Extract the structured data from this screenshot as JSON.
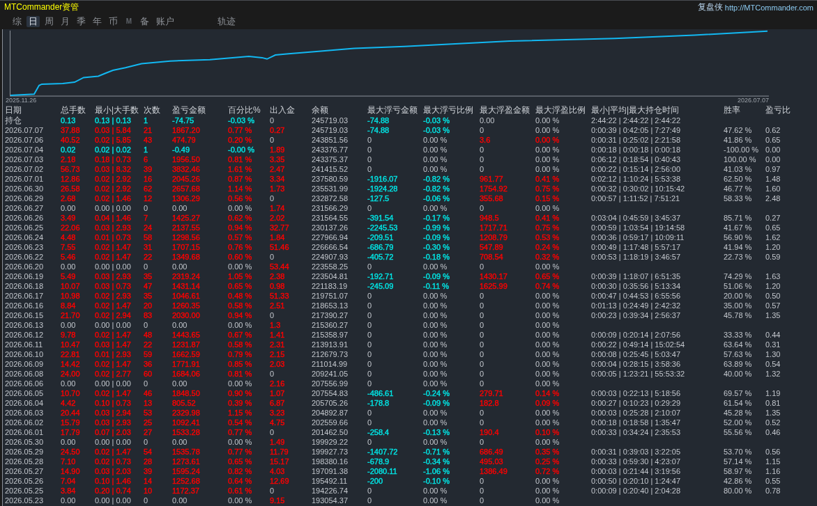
{
  "window": {
    "title": "MTCommander资管"
  },
  "header": {
    "brand": "复盘侠",
    "link": "http://MTCommander.com"
  },
  "tab_groups": [
    {
      "tabs": [
        {
          "label": "综",
          "selected": false,
          "disabled": false
        },
        {
          "label": "日",
          "selected": true,
          "disabled": false
        },
        {
          "label": "周",
          "selected": false,
          "disabled": false
        },
        {
          "label": "月",
          "selected": false,
          "disabled": false
        },
        {
          "label": "季",
          "selected": false,
          "disabled": false
        },
        {
          "label": "年",
          "selected": false,
          "disabled": false
        },
        {
          "label": "币",
          "selected": false,
          "disabled": false
        },
        {
          "label": "M",
          "selected": false,
          "disabled": true
        },
        {
          "label": "备",
          "selected": false,
          "disabled": false
        },
        {
          "label": "账户",
          "selected": false,
          "disabled": false
        }
      ]
    },
    {
      "tabs": [
        {
          "label": "轨迹",
          "selected": false,
          "disabled": false
        }
      ]
    }
  ],
  "chart": {
    "start_label": "2025.11.26",
    "end_label": "2026.07.07"
  },
  "table": {
    "columns": [
      "日期",
      "总手数",
      "最小|大手数",
      "次数",
      "盈亏金额",
      "百分比%",
      "出入金",
      "余额",
      "最大浮亏金额",
      "最大浮亏比例",
      "最大浮盈金额",
      "最大浮盈比例",
      "最小|平均|最大持仓时间",
      "胜率",
      "盈亏比"
    ],
    "summary_row": {
      "cells": [
        "持仓",
        {
          "text": "0.13",
          "color": "#00e6e6"
        },
        {
          "text": "0.13 | 0.13",
          "color": "#00e6e6"
        },
        {
          "text": "1",
          "color": "#00e6e6"
        },
        {
          "text": "-74.75",
          "color": "#00e6e6"
        },
        {
          "text": "-0.03 %",
          "color": "#00e6e6"
        },
        "0",
        "245719.03",
        {
          "text": "-74.88",
          "color": "#00e6e6"
        },
        {
          "text": "-0.03 %",
          "color": "#00e6e6"
        },
        "0.00",
        "0.00 %",
        "2:44:22 | 2:44:22 | 2:44:22"
      ]
    },
    "rows": [
      {
        "cells": [
          "2026.07.07",
          {
            "text": "37.88",
            "color": "#ff0000"
          },
          {
            "text": "0.03 | 5.84",
            "color": "#ff0000"
          },
          {
            "text": "21",
            "color": "#ff0000"
          },
          {
            "text": "1867.20",
            "color": "#ff0000"
          },
          {
            "text": "0.77 %",
            "color": "#ff0000"
          },
          {
            "text": "0.27",
            "color": "#ff0000"
          },
          "245719.03",
          {
            "text": "-74.88",
            "color": "#00e6e6"
          },
          {
            "text": "-0.03 %",
            "color": "#00e6e6"
          },
          "0",
          "0.00 %",
          "0:00:39 | 0:42:05 | 7:27:49",
          "47.62 %",
          "0.62"
        ]
      },
      {
        "cells": [
          "2026.07.06",
          {
            "text": "40.52",
            "color": "#ff0000"
          },
          {
            "text": "0.02 | 5.85",
            "color": "#ff0000"
          },
          {
            "text": "43",
            "color": "#ff0000"
          },
          {
            "text": "474.79",
            "color": "#ff0000"
          },
          {
            "text": "0.20 %",
            "color": "#ff0000"
          },
          "0",
          "243851.56",
          "0",
          "0.00 %",
          {
            "text": "3.6",
            "color": "#ff0000"
          },
          {
            "text": "0.00 %",
            "color": "#ff0000"
          },
          "0:00:31 | 0:25:02 | 2:21:58",
          "41.86 %",
          "0.65"
        ]
      },
      {
        "cells": [
          "2026.07.04",
          {
            "text": "0.02",
            "color": "#00e6e6"
          },
          {
            "text": "0.02 | 0.02",
            "color": "#00e6e6"
          },
          {
            "text": "1",
            "color": "#00e6e6"
          },
          {
            "text": "-0.49",
            "color": "#00e6e6"
          },
          {
            "text": "-0.00 %",
            "color": "#00e6e6"
          },
          {
            "text": "1.89",
            "color": "#ff0000"
          },
          "243376.77",
          "0",
          "0.00 %",
          "0",
          "0.00 %",
          "0:00:18 | 0:00:18 | 0:00:18",
          "-100.00 %",
          "0.00"
        ]
      },
      {
        "cells": [
          "2026.07.03",
          {
            "text": "2.18",
            "color": "#ff0000"
          },
          {
            "text": "0.18 | 0.73",
            "color": "#ff0000"
          },
          {
            "text": "6",
            "color": "#ff0000"
          },
          {
            "text": "1956.50",
            "color": "#ff0000"
          },
          {
            "text": "0.81 %",
            "color": "#ff0000"
          },
          {
            "text": "3.35",
            "color": "#ff0000"
          },
          "243375.37",
          "0",
          "0.00 %",
          "0",
          "0.00 %",
          "0:06:12 | 0:18:54 | 0:40:43",
          "100.00 %",
          "0.00"
        ]
      },
      {
        "cells": [
          "2026.07.02",
          {
            "text": "56.73",
            "color": "#ff0000"
          },
          {
            "text": "0.03 | 8.32",
            "color": "#ff0000"
          },
          {
            "text": "39",
            "color": "#ff0000"
          },
          {
            "text": "3832.46",
            "color": "#ff0000"
          },
          {
            "text": "1.61 %",
            "color": "#ff0000"
          },
          {
            "text": "2.47",
            "color": "#ff0000"
          },
          "241415.52",
          "0",
          "0.00 %",
          "0",
          "0.00 %",
          "0:00:22 | 0:15:14 | 2:56:00",
          "41.03 %",
          "0.97"
        ]
      },
      {
        "cells": [
          "2026.07.01",
          {
            "text": "12.86",
            "color": "#ff0000"
          },
          {
            "text": "0.02 | 2.92",
            "color": "#ff0000"
          },
          {
            "text": "16",
            "color": "#ff0000"
          },
          {
            "text": "2045.26",
            "color": "#ff0000"
          },
          {
            "text": "0.87 %",
            "color": "#ff0000"
          },
          {
            "text": "3.34",
            "color": "#ff0000"
          },
          "237580.59",
          {
            "text": "-1916.07",
            "color": "#00e6e6"
          },
          {
            "text": "-0.82 %",
            "color": "#00e6e6"
          },
          {
            "text": "961.77",
            "color": "#ff0000"
          },
          {
            "text": "0.41 %",
            "color": "#ff0000"
          },
          "0:02:12 | 1:10:24 | 5:53:38",
          "62.50 %",
          "1.48"
        ]
      },
      {
        "cells": [
          "2026.06.30",
          {
            "text": "26.58",
            "color": "#ff0000"
          },
          {
            "text": "0.02 | 2.92",
            "color": "#ff0000"
          },
          {
            "text": "62",
            "color": "#ff0000"
          },
          {
            "text": "2657.68",
            "color": "#ff0000"
          },
          {
            "text": "1.14 %",
            "color": "#ff0000"
          },
          {
            "text": "1.73",
            "color": "#ff0000"
          },
          "235531.99",
          {
            "text": "-1924.28",
            "color": "#00e6e6"
          },
          {
            "text": "-0.82 %",
            "color": "#00e6e6"
          },
          {
            "text": "1754.92",
            "color": "#ff0000"
          },
          {
            "text": "0.75 %",
            "color": "#ff0000"
          },
          "0:00:32 | 0:30:02 | 10:15:42",
          "46.77 %",
          "1.60"
        ]
      },
      {
        "cells": [
          "2026.06.29",
          {
            "text": "2.68",
            "color": "#ff0000"
          },
          {
            "text": "0.02 | 1.46",
            "color": "#ff0000"
          },
          {
            "text": "12",
            "color": "#ff0000"
          },
          {
            "text": "1306.29",
            "color": "#ff0000"
          },
          {
            "text": "0.56 %",
            "color": "#ff0000"
          },
          "0",
          "232872.58",
          {
            "text": "-127.5",
            "color": "#00e6e6"
          },
          {
            "text": "-0.06 %",
            "color": "#00e6e6"
          },
          {
            "text": "355.68",
            "color": "#ff0000"
          },
          {
            "text": "0.15 %",
            "color": "#ff0000"
          },
          "0:00:57 | 1:11:52 | 7:51:21",
          "58.33 %",
          "2.48"
        ]
      },
      {
        "cells": [
          "2026.06.27",
          "0.00",
          "0.00 | 0.00",
          "0",
          "0.00",
          "0.00 %",
          {
            "text": "1.74",
            "color": "#ff0000"
          },
          "231566.29",
          "0",
          "0.00 %",
          "0",
          "0.00 %"
        ]
      },
      {
        "cells": [
          "2026.06.26",
          {
            "text": "3.49",
            "color": "#ff0000"
          },
          {
            "text": "0.04 | 1.46",
            "color": "#ff0000"
          },
          {
            "text": "7",
            "color": "#ff0000"
          },
          {
            "text": "1425.27",
            "color": "#ff0000"
          },
          {
            "text": "0.62 %",
            "color": "#ff0000"
          },
          {
            "text": "2.02",
            "color": "#ff0000"
          },
          "231564.55",
          {
            "text": "-391.54",
            "color": "#00e6e6"
          },
          {
            "text": "-0.17 %",
            "color": "#00e6e6"
          },
          {
            "text": "948.5",
            "color": "#ff0000"
          },
          {
            "text": "0.41 %",
            "color": "#ff0000"
          },
          "0:03:04 | 0:45:59 | 3:45:37",
          "85.71 %",
          "0.27"
        ]
      },
      {
        "cells": [
          "2026.06.25",
          {
            "text": "22.06",
            "color": "#ff0000"
          },
          {
            "text": "0.03 | 2.93",
            "color": "#ff0000"
          },
          {
            "text": "24",
            "color": "#ff0000"
          },
          {
            "text": "2137.55",
            "color": "#ff0000"
          },
          {
            "text": "0.94 %",
            "color": "#ff0000"
          },
          {
            "text": "32.77",
            "color": "#ff0000"
          },
          "230137.26",
          {
            "text": "-2245.53",
            "color": "#00e6e6"
          },
          {
            "text": "-0.99 %",
            "color": "#00e6e6"
          },
          {
            "text": "1717.71",
            "color": "#ff0000"
          },
          {
            "text": "0.75 %",
            "color": "#ff0000"
          },
          "0:00:59 | 1:03:54 | 19:14:58",
          "41.67 %",
          "0.65"
        ]
      },
      {
        "cells": [
          "2026.06.24",
          {
            "text": "4.48",
            "color": "#ff0000"
          },
          {
            "text": "0.01 | 0.73",
            "color": "#ff0000"
          },
          {
            "text": "58",
            "color": "#ff0000"
          },
          {
            "text": "1298.56",
            "color": "#ff0000"
          },
          {
            "text": "0.57 %",
            "color": "#ff0000"
          },
          {
            "text": "1.84",
            "color": "#ff0000"
          },
          "227966.94",
          {
            "text": "-209.51",
            "color": "#00e6e6"
          },
          {
            "text": "-0.09 %",
            "color": "#00e6e6"
          },
          {
            "text": "1208.79",
            "color": "#ff0000"
          },
          {
            "text": "0.53 %",
            "color": "#ff0000"
          },
          "0:00:36 | 0:59:17 | 10:09:11",
          "56.90 %",
          "1.62"
        ]
      },
      {
        "cells": [
          "2026.06.23",
          {
            "text": "7.55",
            "color": "#ff0000"
          },
          {
            "text": "0.02 | 1.47",
            "color": "#ff0000"
          },
          {
            "text": "31",
            "color": "#ff0000"
          },
          {
            "text": "1707.15",
            "color": "#ff0000"
          },
          {
            "text": "0.76 %",
            "color": "#ff0000"
          },
          {
            "text": "51.46",
            "color": "#ff0000"
          },
          "226666.54",
          {
            "text": "-686.79",
            "color": "#00e6e6"
          },
          {
            "text": "-0.30 %",
            "color": "#00e6e6"
          },
          {
            "text": "547.89",
            "color": "#ff0000"
          },
          {
            "text": "0.24 %",
            "color": "#ff0000"
          },
          "0:00:49 | 1:17:48 | 5:57:17",
          "41.94 %",
          "1.20"
        ]
      },
      {
        "cells": [
          "2026.06.22",
          {
            "text": "5.46",
            "color": "#ff0000"
          },
          {
            "text": "0.02 | 1.47",
            "color": "#ff0000"
          },
          {
            "text": "22",
            "color": "#ff0000"
          },
          {
            "text": "1349.68",
            "color": "#ff0000"
          },
          {
            "text": "0.60 %",
            "color": "#ff0000"
          },
          "0",
          "224907.93",
          {
            "text": "-405.72",
            "color": "#00e6e6"
          },
          {
            "text": "-0.18 %",
            "color": "#00e6e6"
          },
          {
            "text": "708.54",
            "color": "#ff0000"
          },
          {
            "text": "0.32 %",
            "color": "#ff0000"
          },
          "0:00:53 | 1:18:19 | 3:46:57",
          "22.73 %",
          "0.59"
        ]
      },
      {
        "cells": [
          "2026.06.20",
          "0.00",
          "0.00 | 0.00",
          "0",
          "0.00",
          "0.00 %",
          {
            "text": "53.44",
            "color": "#ff0000"
          },
          "223558.25",
          "0",
          "0.00 %",
          "0",
          "0.00 %"
        ]
      },
      {
        "cells": [
          "2026.06.19",
          {
            "text": "5.49",
            "color": "#ff0000"
          },
          {
            "text": "0.03 | 2.93",
            "color": "#ff0000"
          },
          {
            "text": "35",
            "color": "#ff0000"
          },
          {
            "text": "2319.24",
            "color": "#ff0000"
          },
          {
            "text": "1.05 %",
            "color": "#ff0000"
          },
          {
            "text": "2.38",
            "color": "#ff0000"
          },
          "223504.81",
          {
            "text": "-192.71",
            "color": "#00e6e6"
          },
          {
            "text": "-0.09 %",
            "color": "#00e6e6"
          },
          {
            "text": "1430.17",
            "color": "#ff0000"
          },
          {
            "text": "0.65 %",
            "color": "#ff0000"
          },
          "0:00:39 | 1:18:07 | 6:51:35",
          "74.29 %",
          "1.63"
        ]
      },
      {
        "cells": [
          "2026.06.18",
          {
            "text": "10.07",
            "color": "#ff0000"
          },
          {
            "text": "0.03 | 0.73",
            "color": "#ff0000"
          },
          {
            "text": "47",
            "color": "#ff0000"
          },
          {
            "text": "1431.14",
            "color": "#ff0000"
          },
          {
            "text": "0.65 %",
            "color": "#ff0000"
          },
          {
            "text": "0.98",
            "color": "#ff0000"
          },
          "221183.19",
          {
            "text": "-245.09",
            "color": "#00e6e6"
          },
          {
            "text": "-0.11 %",
            "color": "#00e6e6"
          },
          {
            "text": "1625.99",
            "color": "#ff0000"
          },
          {
            "text": "0.74 %",
            "color": "#ff0000"
          },
          "0:00:30 | 0:35:56 | 5:13:34",
          "51.06 %",
          "1.20"
        ]
      },
      {
        "cells": [
          "2026.06.17",
          {
            "text": "10.98",
            "color": "#ff0000"
          },
          {
            "text": "0.02 | 2.93",
            "color": "#ff0000"
          },
          {
            "text": "35",
            "color": "#ff0000"
          },
          {
            "text": "1046.61",
            "color": "#ff0000"
          },
          {
            "text": "0.48 %",
            "color": "#ff0000"
          },
          {
            "text": "51.33",
            "color": "#ff0000"
          },
          "219751.07",
          "0",
          "0.00 %",
          "0",
          "0.00 %",
          "0:00:47 | 0:44:53 | 6:55:56",
          "20.00 %",
          "0.50"
        ]
      },
      {
        "cells": [
          "2026.06.16",
          {
            "text": "8.84",
            "color": "#ff0000"
          },
          {
            "text": "0.02 | 1.47",
            "color": "#ff0000"
          },
          {
            "text": "20",
            "color": "#ff0000"
          },
          {
            "text": "1260.35",
            "color": "#ff0000"
          },
          {
            "text": "0.58 %",
            "color": "#ff0000"
          },
          {
            "text": "2.51",
            "color": "#ff0000"
          },
          "218653.13",
          "0",
          "0.00 %",
          "0",
          "0.00 %",
          "0:01:13 | 0:24:49 | 2:42:32",
          "35.00 %",
          "0.57"
        ]
      },
      {
        "cells": [
          "2026.06.15",
          {
            "text": "21.70",
            "color": "#ff0000"
          },
          {
            "text": "0.02 | 2.94",
            "color": "#ff0000"
          },
          {
            "text": "83",
            "color": "#ff0000"
          },
          {
            "text": "2030.00",
            "color": "#ff0000"
          },
          {
            "text": "0.94 %",
            "color": "#ff0000"
          },
          "0",
          "217390.27",
          "0",
          "0.00 %",
          "0",
          "0.00 %",
          "0:00:23 | 0:39:34 | 2:56:37",
          "45.78 %",
          "1.35"
        ]
      },
      {
        "cells": [
          "2026.06.13",
          "0.00",
          "0.00 | 0.00",
          "0",
          "0.00",
          "0.00 %",
          {
            "text": "1.3",
            "color": "#ff0000"
          },
          "215360.27",
          "0",
          "0.00 %",
          "0",
          "0.00 %"
        ]
      },
      {
        "cells": [
          "2026.06.12",
          {
            "text": "9.78",
            "color": "#ff0000"
          },
          {
            "text": "0.02 | 1.47",
            "color": "#ff0000"
          },
          {
            "text": "48",
            "color": "#ff0000"
          },
          {
            "text": "1443.65",
            "color": "#ff0000"
          },
          {
            "text": "0.67 %",
            "color": "#ff0000"
          },
          {
            "text": "1.41",
            "color": "#ff0000"
          },
          "215358.97",
          "0",
          "0.00 %",
          "0",
          "0.00 %",
          "0:00:09 | 0:20:14 | 2:07:56",
          "33.33 %",
          "0.44"
        ]
      },
      {
        "cells": [
          "2026.06.11",
          {
            "text": "10.47",
            "color": "#ff0000"
          },
          {
            "text": "0.03 | 1.47",
            "color": "#ff0000"
          },
          {
            "text": "22",
            "color": "#ff0000"
          },
          {
            "text": "1231.87",
            "color": "#ff0000"
          },
          {
            "text": "0.58 %",
            "color": "#ff0000"
          },
          {
            "text": "2.31",
            "color": "#ff0000"
          },
          "213913.91",
          "0",
          "0.00 %",
          "0",
          "0.00 %",
          "0:00:22 | 0:49:14 | 15:02:54",
          "63.64 %",
          "0.31"
        ]
      },
      {
        "cells": [
          "2026.06.10",
          {
            "text": "22.81",
            "color": "#ff0000"
          },
          {
            "text": "0.01 | 2.93",
            "color": "#ff0000"
          },
          {
            "text": "59",
            "color": "#ff0000"
          },
          {
            "text": "1662.59",
            "color": "#ff0000"
          },
          {
            "text": "0.79 %",
            "color": "#ff0000"
          },
          {
            "text": "2.15",
            "color": "#ff0000"
          },
          "212679.73",
          "0",
          "0.00 %",
          "0",
          "0.00 %",
          "0:00:08 | 0:25:45 | 5:03:47",
          "57.63 %",
          "1.30"
        ]
      },
      {
        "cells": [
          "2026.06.09",
          {
            "text": "14.42",
            "color": "#ff0000"
          },
          {
            "text": "0.02 | 1.47",
            "color": "#ff0000"
          },
          {
            "text": "36",
            "color": "#ff0000"
          },
          {
            "text": "1771.91",
            "color": "#ff0000"
          },
          {
            "text": "0.85 %",
            "color": "#ff0000"
          },
          {
            "text": "2.03",
            "color": "#ff0000"
          },
          "211014.99",
          "0",
          "0.00 %",
          "0",
          "0.00 %",
          "0:00:04 | 0:28:15 | 3:58:36",
          "63.89 %",
          "0.54"
        ]
      },
      {
        "cells": [
          "2026.06.08",
          {
            "text": "24.00",
            "color": "#ff0000"
          },
          {
            "text": "0.02 | 2.77",
            "color": "#ff0000"
          },
          {
            "text": "60",
            "color": "#ff0000"
          },
          {
            "text": "1684.06",
            "color": "#ff0000"
          },
          {
            "text": "0.81 %",
            "color": "#ff0000"
          },
          "0",
          "209241.05",
          "0",
          "0.00 %",
          "0",
          "0.00 %",
          "0:00:05 | 1:23:21 | 55:53:32",
          "40.00 %",
          "1.32"
        ]
      },
      {
        "cells": [
          "2026.06.06",
          "0.00",
          "0.00 | 0.00",
          "0",
          "0.00",
          "0.00 %",
          {
            "text": "2.16",
            "color": "#ff0000"
          },
          "207556.99",
          "0",
          "0.00 %",
          "0",
          "0.00 %"
        ]
      },
      {
        "cells": [
          "2026.06.05",
          {
            "text": "10.70",
            "color": "#ff0000"
          },
          {
            "text": "0.02 | 1.47",
            "color": "#ff0000"
          },
          {
            "text": "46",
            "color": "#ff0000"
          },
          {
            "text": "1848.50",
            "color": "#ff0000"
          },
          {
            "text": "0.90 %",
            "color": "#ff0000"
          },
          {
            "text": "1.07",
            "color": "#ff0000"
          },
          "207554.83",
          {
            "text": "-486.61",
            "color": "#00e6e6"
          },
          {
            "text": "-0.24 %",
            "color": "#00e6e6"
          },
          {
            "text": "279.71",
            "color": "#ff0000"
          },
          {
            "text": "0.14 %",
            "color": "#ff0000"
          },
          "0:00:03 | 0:22:13 | 5:18:56",
          "69.57 %",
          "1.19"
        ]
      },
      {
        "cells": [
          "2026.06.04",
          {
            "text": "4.42",
            "color": "#ff0000"
          },
          {
            "text": "0.10 | 0.73",
            "color": "#ff0000"
          },
          {
            "text": "13",
            "color": "#ff0000"
          },
          {
            "text": "805.52",
            "color": "#ff0000"
          },
          {
            "text": "0.39 %",
            "color": "#ff0000"
          },
          {
            "text": "6.87",
            "color": "#ff0000"
          },
          "205705.26",
          {
            "text": "-178.8",
            "color": "#00e6e6"
          },
          {
            "text": "-0.09 %",
            "color": "#00e6e6"
          },
          {
            "text": "182.8",
            "color": "#ff0000"
          },
          {
            "text": "0.09 %",
            "color": "#ff0000"
          },
          "0:00:27 | 0:10:23 | 0:29:29",
          "61.54 %",
          "0.81"
        ]
      },
      {
        "cells": [
          "2026.06.03",
          {
            "text": "20.44",
            "color": "#ff0000"
          },
          {
            "text": "0.03 | 2.94",
            "color": "#ff0000"
          },
          {
            "text": "53",
            "color": "#ff0000"
          },
          {
            "text": "2329.98",
            "color": "#ff0000"
          },
          {
            "text": "1.15 %",
            "color": "#ff0000"
          },
          {
            "text": "3.23",
            "color": "#ff0000"
          },
          "204892.87",
          "0",
          "0.00 %",
          "0",
          "0.00 %",
          "0:00:03 | 0:25:28 | 2:10:07",
          "45.28 %",
          "1.35"
        ]
      },
      {
        "cells": [
          "2026.06.02",
          {
            "text": "15.79",
            "color": "#ff0000"
          },
          {
            "text": "0.03 | 2.93",
            "color": "#ff0000"
          },
          {
            "text": "25",
            "color": "#ff0000"
          },
          {
            "text": "1092.41",
            "color": "#ff0000"
          },
          {
            "text": "0.54 %",
            "color": "#ff0000"
          },
          {
            "text": "4.75",
            "color": "#ff0000"
          },
          "202559.66",
          "0",
          "0.00 %",
          "0",
          "0.00 %",
          "0:00:18 | 0:18:58 | 1:35:47",
          "52.00 %",
          "0.52"
        ]
      },
      {
        "cells": [
          "2026.06.01",
          {
            "text": "17.79",
            "color": "#ff0000"
          },
          {
            "text": "0.07 | 2.03",
            "color": "#ff0000"
          },
          {
            "text": "27",
            "color": "#ff0000"
          },
          {
            "text": "1533.28",
            "color": "#ff0000"
          },
          {
            "text": "0.77 %",
            "color": "#ff0000"
          },
          "0",
          "201462.50",
          {
            "text": "-258.4",
            "color": "#00e6e6"
          },
          {
            "text": "-0.13 %",
            "color": "#00e6e6"
          },
          {
            "text": "190.4",
            "color": "#ff0000"
          },
          {
            "text": "0.10 %",
            "color": "#ff0000"
          },
          "0:00:33 | 0:34:24 | 2:35:53",
          "55.56 %",
          "0.46"
        ]
      },
      {
        "cells": [
          "2026.05.30",
          "0.00",
          "0.00 | 0.00",
          "0",
          "0.00",
          "0.00 %",
          {
            "text": "1.49",
            "color": "#ff0000"
          },
          "199929.22",
          "0",
          "0.00 %",
          "0",
          "0.00 %"
        ]
      },
      {
        "cells": [
          "2026.05.29",
          {
            "text": "24.50",
            "color": "#ff0000"
          },
          {
            "text": "0.02 | 1.47",
            "color": "#ff0000"
          },
          {
            "text": "54",
            "color": "#ff0000"
          },
          {
            "text": "1535.78",
            "color": "#ff0000"
          },
          {
            "text": "0.77 %",
            "color": "#ff0000"
          },
          {
            "text": "11.79",
            "color": "#ff0000"
          },
          "199927.73",
          {
            "text": "-1407.72",
            "color": "#00e6e6"
          },
          {
            "text": "-0.71 %",
            "color": "#00e6e6"
          },
          {
            "text": "686.49",
            "color": "#ff0000"
          },
          {
            "text": "0.35 %",
            "color": "#ff0000"
          },
          "0:00:31 | 0:39:03 | 3:22:05",
          "53.70 %",
          "0.56"
        ]
      },
      {
        "cells": [
          "2026.05.28",
          {
            "text": "7.10",
            "color": "#ff0000"
          },
          {
            "text": "0.02 | 0.73",
            "color": "#ff0000"
          },
          {
            "text": "28",
            "color": "#ff0000"
          },
          {
            "text": "1273.61",
            "color": "#ff0000"
          },
          {
            "text": "0.65 %",
            "color": "#ff0000"
          },
          {
            "text": "15.17",
            "color": "#ff0000"
          },
          "198380.16",
          {
            "text": "-678.9",
            "color": "#00e6e6"
          },
          {
            "text": "-0.34 %",
            "color": "#00e6e6"
          },
          {
            "text": "495.03",
            "color": "#ff0000"
          },
          {
            "text": "0.25 %",
            "color": "#ff0000"
          },
          "0:00:33 | 0:59:30 | 4:23:07",
          "57.14 %",
          "1.15"
        ]
      },
      {
        "cells": [
          "2026.05.27",
          {
            "text": "14.90",
            "color": "#ff0000"
          },
          {
            "text": "0.03 | 2.03",
            "color": "#ff0000"
          },
          {
            "text": "39",
            "color": "#ff0000"
          },
          {
            "text": "1595.24",
            "color": "#ff0000"
          },
          {
            "text": "0.82 %",
            "color": "#ff0000"
          },
          {
            "text": "4.03",
            "color": "#ff0000"
          },
          "197091.38",
          {
            "text": "-2080.11",
            "color": "#00e6e6"
          },
          {
            "text": "-1.06 %",
            "color": "#00e6e6"
          },
          {
            "text": "1386.49",
            "color": "#ff0000"
          },
          {
            "text": "0.72 %",
            "color": "#ff0000"
          },
          "0:00:03 | 0:21:44 | 3:19:56",
          "58.97 %",
          "1.16"
        ]
      },
      {
        "cells": [
          "2026.05.26",
          {
            "text": "7.04",
            "color": "#ff0000"
          },
          {
            "text": "0.10 | 1.46",
            "color": "#ff0000"
          },
          {
            "text": "14",
            "color": "#ff0000"
          },
          {
            "text": "1252.68",
            "color": "#ff0000"
          },
          {
            "text": "0.64 %",
            "color": "#ff0000"
          },
          {
            "text": "12.69",
            "color": "#ff0000"
          },
          "195492.11",
          {
            "text": "-200",
            "color": "#00e6e6"
          },
          {
            "text": "-0.10 %",
            "color": "#00e6e6"
          },
          "0",
          "0.00 %",
          "0:00:50 | 0:20:10 | 1:24:47",
          "42.86 %",
          "0.55"
        ]
      },
      {
        "cells": [
          "2026.05.25",
          {
            "text": "3.84",
            "color": "#ff0000"
          },
          {
            "text": "0.20 | 0.74",
            "color": "#ff0000"
          },
          {
            "text": "10",
            "color": "#ff0000"
          },
          {
            "text": "1172.37",
            "color": "#ff0000"
          },
          {
            "text": "0.61 %",
            "color": "#ff0000"
          },
          "0",
          "194226.74",
          "0",
          "0.00 %",
          "0",
          "0.00 %",
          "0:00:09 | 0:20:40 | 2:04:28",
          "80.00 %",
          "0.78"
        ]
      },
      {
        "cells": [
          "2026.05.23",
          "0.00",
          "0.00 | 0.00",
          "0",
          "0.00",
          "0.00 %",
          {
            "text": "9.15",
            "color": "#ff0000"
          },
          "193054.37",
          "0",
          "0.00 %",
          "0",
          "0.00 %"
        ]
      }
    ]
  }
}
